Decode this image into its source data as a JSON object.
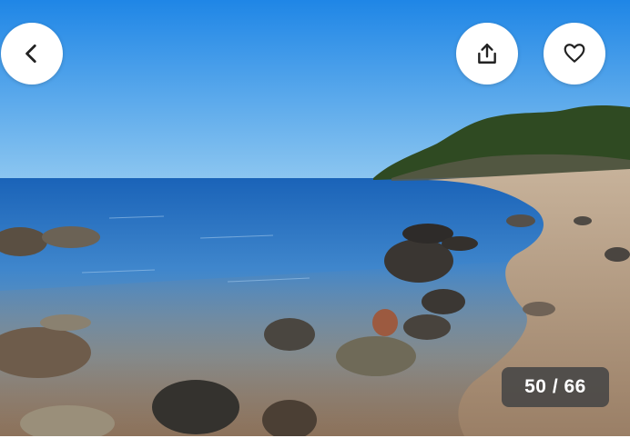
{
  "photo": {
    "description_icon": "beach-photo"
  },
  "buttons": {
    "back_icon": "chevron-left-icon",
    "share_icon": "share-icon",
    "save_icon": "heart-icon"
  },
  "counter": {
    "current": "50",
    "separator": " / ",
    "total": "66"
  },
  "colors": {
    "button_bg": "#ffffff",
    "counter_bg": "#464646",
    "icon": "#222222"
  }
}
